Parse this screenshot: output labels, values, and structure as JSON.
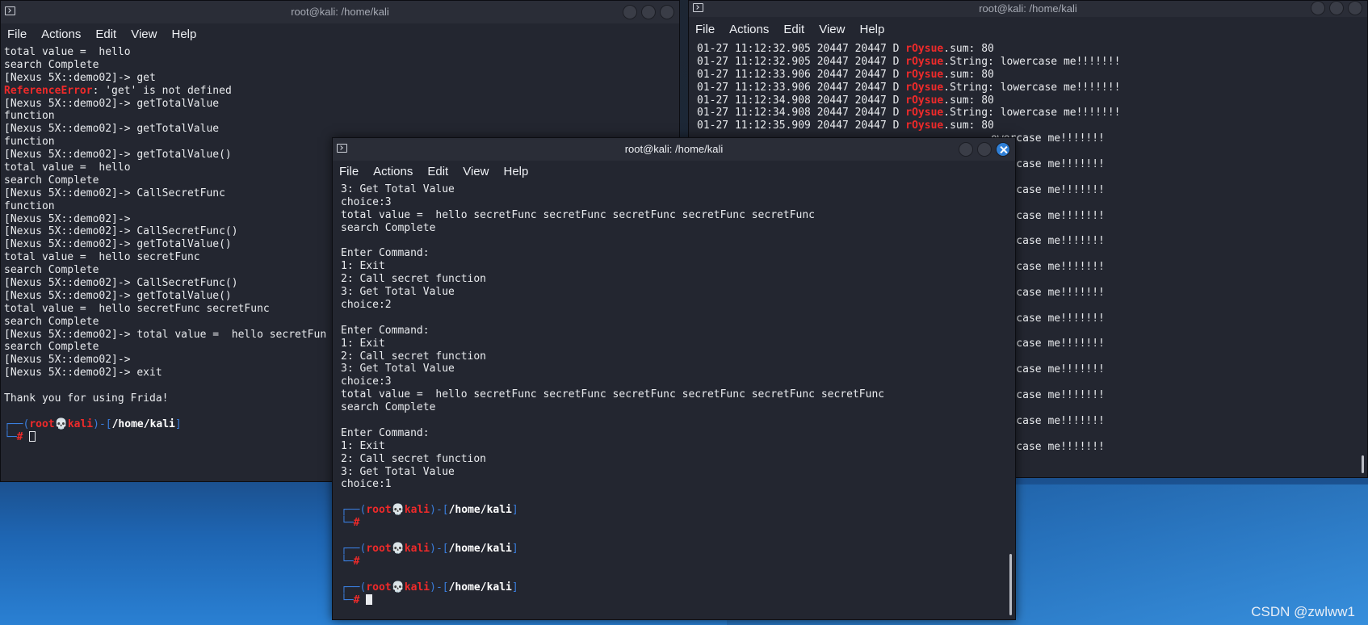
{
  "watermark": "CSDN @zwlww1",
  "menu": [
    "File",
    "Actions",
    "Edit",
    "View",
    "Help"
  ],
  "left_window": {
    "title": "root@kali: /home/kali",
    "lines": [
      {
        "t": "total value =  hello"
      },
      {
        "t": "search Complete"
      },
      {
        "t": "[Nexus 5X::demo02]-> get"
      },
      {
        "err": "ReferenceError",
        "t": ": 'get' is not defined"
      },
      {
        "t": "[Nexus 5X::demo02]-> getTotalValue"
      },
      {
        "t": "function"
      },
      {
        "t": "[Nexus 5X::demo02]-> getTotalValue"
      },
      {
        "t": "function"
      },
      {
        "t": "[Nexus 5X::demo02]-> getTotalValue()"
      },
      {
        "t": "total value =  hello"
      },
      {
        "t": "search Complete"
      },
      {
        "t": "[Nexus 5X::demo02]-> CallSecretFunc"
      },
      {
        "t": "function"
      },
      {
        "t": "[Nexus 5X::demo02]->"
      },
      {
        "t": "[Nexus 5X::demo02]-> CallSecretFunc()"
      },
      {
        "t": "[Nexus 5X::demo02]-> getTotalValue()"
      },
      {
        "t": "total value =  hello secretFunc"
      },
      {
        "t": "search Complete"
      },
      {
        "t": "[Nexus 5X::demo02]-> CallSecretFunc()"
      },
      {
        "t": "[Nexus 5X::demo02]-> getTotalValue()"
      },
      {
        "t": "total value =  hello secretFunc secretFunc"
      },
      {
        "t": "search Complete"
      },
      {
        "t": "[Nexus 5X::demo02]-> total value =  hello secretFun"
      },
      {
        "t": "search Complete"
      },
      {
        "t": "[Nexus 5X::demo02]->"
      },
      {
        "t": "[Nexus 5X::demo02]-> exit"
      },
      {
        "t": ""
      },
      {
        "t": "Thank you for using Frida!"
      }
    ],
    "prompt": {
      "user": "root",
      "skull": "💀",
      "host": "kali",
      "path": "/home/kali",
      "hash": "#"
    }
  },
  "right_window": {
    "title": "root@kali: /home/kali",
    "visible": [
      {
        "ts": "01-27 11:12:32.905 20447 20447 D ",
        "tag": "rOysue",
        "msg": ".sum: 80"
      },
      {
        "ts": "01-27 11:12:32.905 20447 20447 D ",
        "tag": "rOysue",
        "msg": ".String: lowercase me!!!!!!!"
      },
      {
        "ts": "01-27 11:12:33.906 20447 20447 D ",
        "tag": "rOysue",
        "msg": ".sum: 80"
      },
      {
        "ts": "01-27 11:12:33.906 20447 20447 D ",
        "tag": "rOysue",
        "msg": ".String: lowercase me!!!!!!!"
      },
      {
        "ts": "01-27 11:12:34.908 20447 20447 D ",
        "tag": "rOysue",
        "msg": ".sum: 80"
      },
      {
        "ts": "01-27 11:12:34.908 20447 20447 D ",
        "tag": "rOysue",
        "msg": ".String: lowercase me!!!!!!!"
      },
      {
        "ts": "01-27 11:12:35.909 20447 20447 D ",
        "tag": "rOysue",
        "msg": ".sum: 80"
      }
    ],
    "tail": "owercase me!!!!!!!"
  },
  "front_window": {
    "title": "root@kali: /home/kali",
    "lines": [
      "3: Get Total Value",
      "choice:3",
      "total value =  hello secretFunc secretFunc secretFunc secretFunc secretFunc",
      "search Complete",
      "",
      "Enter Command:",
      "1: Exit",
      "2: Call secret function",
      "3: Get Total Value",
      "choice:2",
      "",
      "Enter Command:",
      "1: Exit",
      "2: Call secret function",
      "3: Get Total Value",
      "choice:3",
      "total value =  hello secretFunc secretFunc secretFunc secretFunc secretFunc secretFunc",
      "search Complete",
      "",
      "Enter Command:",
      "1: Exit",
      "2: Call secret function",
      "3: Get Total Value",
      "choice:1"
    ],
    "prompt": {
      "user": "root",
      "skull": "💀",
      "host": "kali",
      "path": "/home/kali",
      "hash": "#"
    }
  }
}
